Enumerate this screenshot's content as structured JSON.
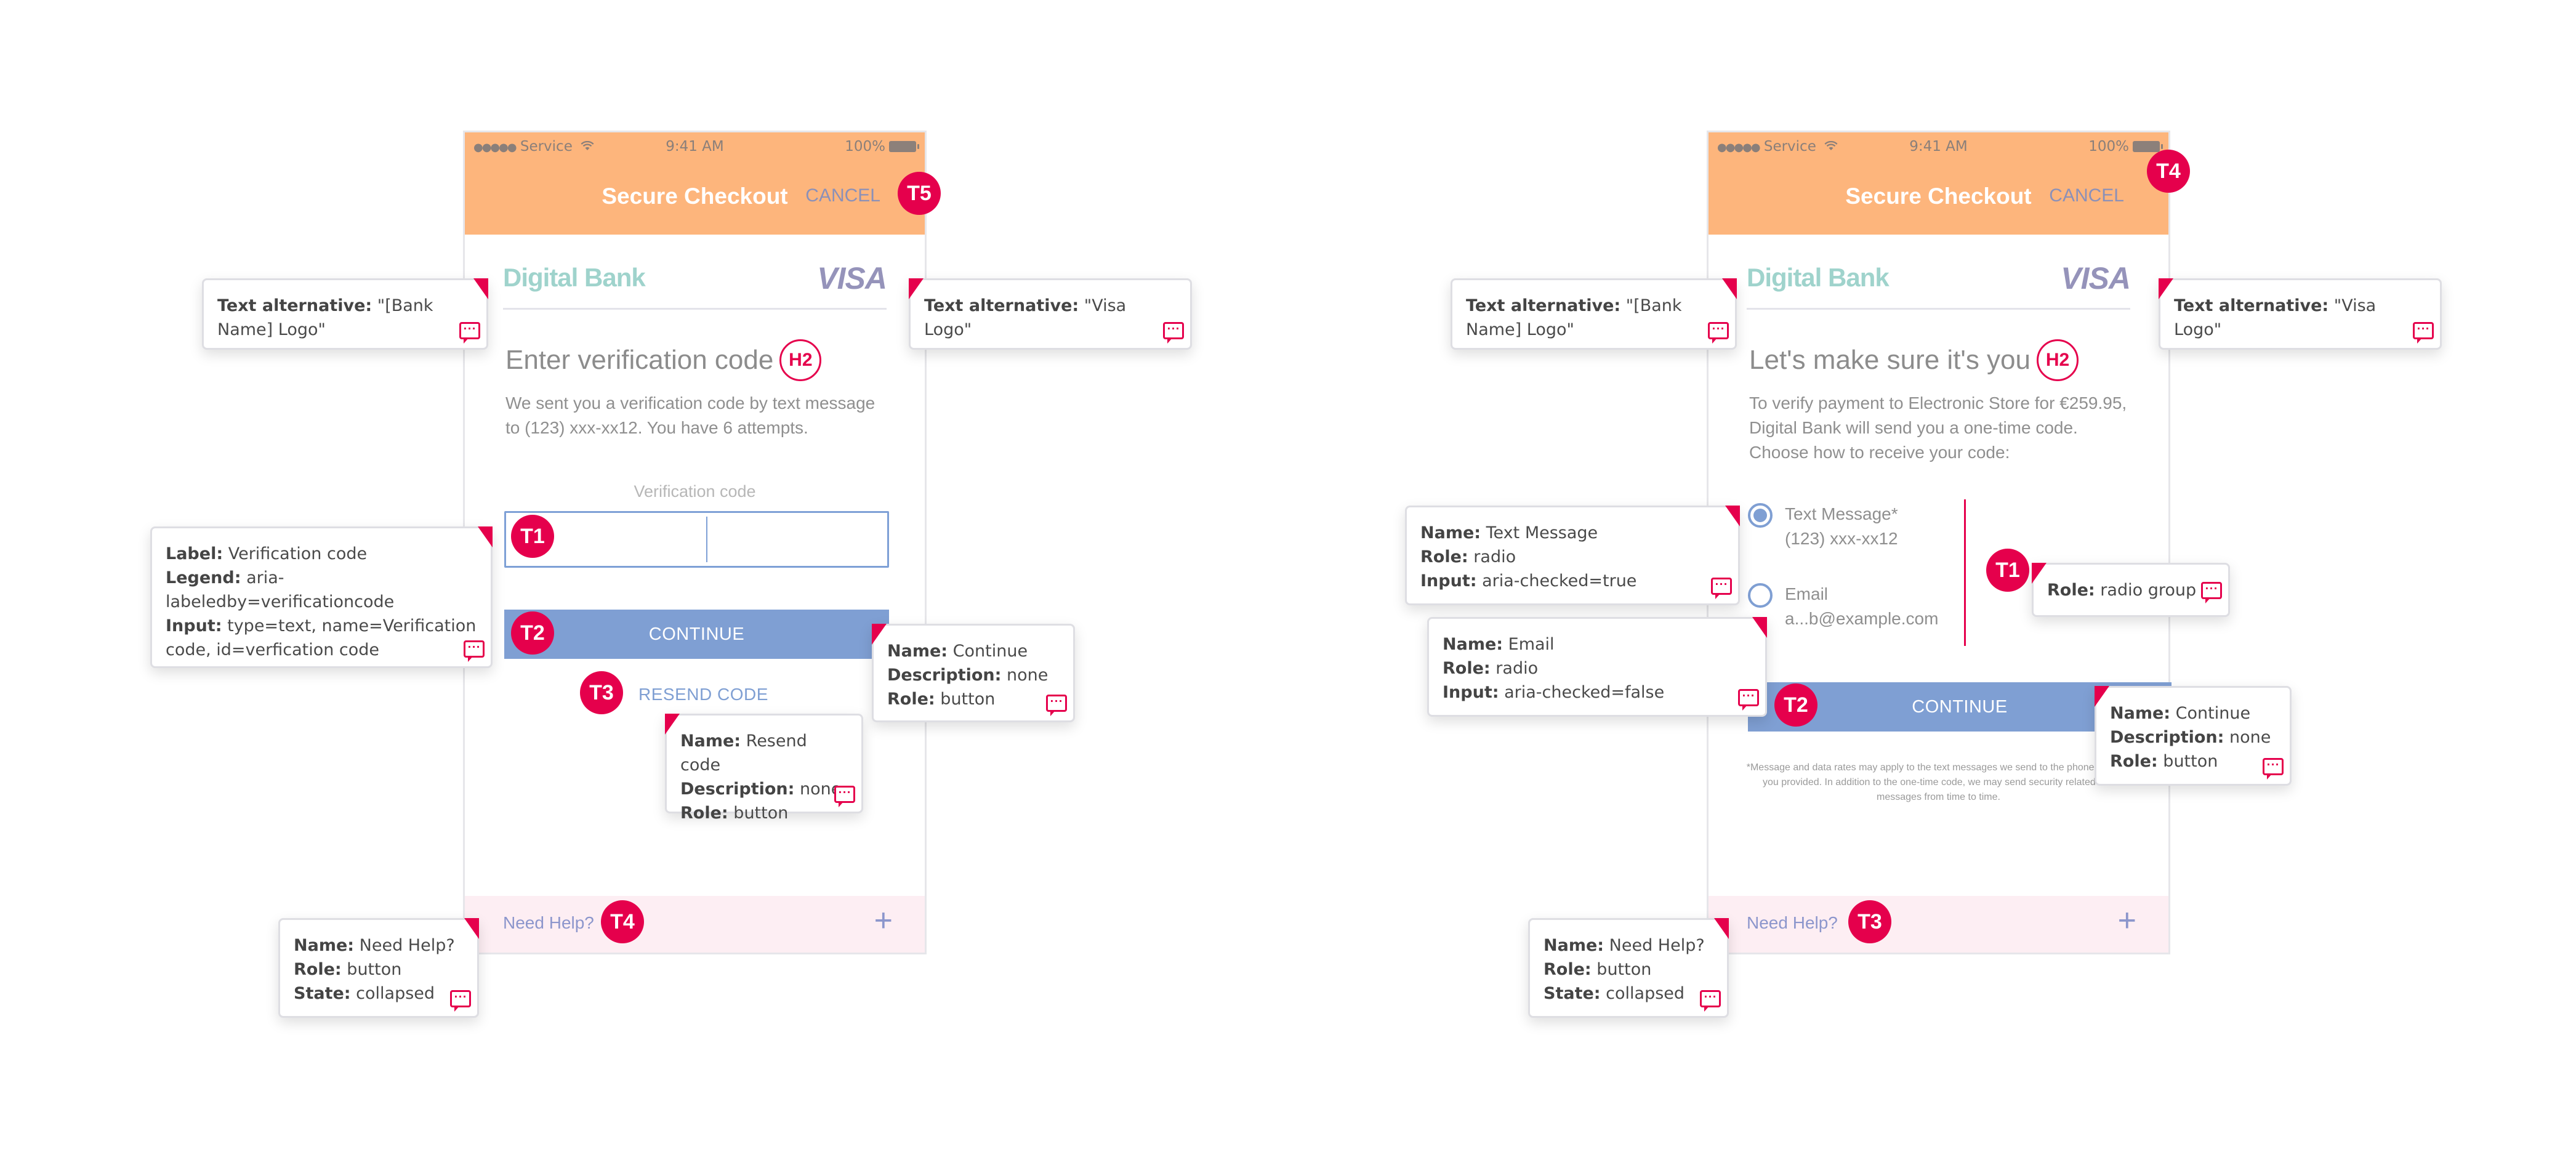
{
  "colors": {
    "header_bg": "#fdb57c",
    "annotation_accent": "#e5004c",
    "button_bg": "#7f9fd3",
    "help_band_bg": "#fdeef3",
    "bank_logo": "#9fd3cc",
    "visa_logo": "#9593ba"
  },
  "icons": {
    "comment": "speech-bubble-with-ellipsis",
    "wifi": "wifi-icon",
    "battery": "battery-full-icon",
    "signal": "signal-dots-icon",
    "plus": "plus-icon"
  },
  "status_bar": {
    "signal": "●●●●●",
    "carrier": "Service",
    "time": "9:41 AM",
    "battery": "100%"
  },
  "screens": [
    {
      "header": {
        "title": "Secure Checkout",
        "cancel": "CANCEL",
        "cancel_tag": "T5"
      },
      "bank_logo": "Digital Bank",
      "visa_logo": "VISA",
      "heading": "Enter verification code",
      "heading_tag": "H2",
      "description": "We sent you a verification code by text message to (123) xxx-xx12. You have 6 attempts.",
      "input_label": "Verification code",
      "input_value": "",
      "input_tag": "T1",
      "continue_label": "CONTINUE",
      "continue_tag": "T2",
      "resend_label": "RESEND CODE",
      "resend_tag": "T3",
      "help_label": "Need Help?",
      "help_tag": "T4",
      "help_icon": "+",
      "callouts": {
        "bank_logo": [
          {
            "k": "Text alternative:",
            "v": " \"[Bank Name] Logo\""
          }
        ],
        "visa_logo": [
          {
            "k": "Text alternative:",
            "v": " \"Visa Logo\""
          }
        ],
        "input": [
          {
            "k": "Label:",
            "v": " Verification code"
          },
          {
            "k": "Legend:",
            "v": " aria-labeledby=verificationcode"
          },
          {
            "k": "Input:",
            "v": " type=text, name=Verification code, id=verfication code"
          }
        ],
        "continue": [
          {
            "k": "Name:",
            "v": " Continue"
          },
          {
            "k": "Description:",
            "v": " none"
          },
          {
            "k": "Role:",
            "v": " button"
          }
        ],
        "resend": [
          {
            "k": "Name:",
            "v": " Resend code"
          },
          {
            "k": "Description:",
            "v": " none"
          },
          {
            "k": "Role:",
            "v": " button"
          }
        ],
        "help": [
          {
            "k": "Name:",
            "v": " Need Help?"
          },
          {
            "k": "Role:",
            "v": " button"
          },
          {
            "k": "State:",
            "v": " collapsed"
          }
        ]
      }
    },
    {
      "header": {
        "title": "Secure Checkout",
        "cancel": "CANCEL",
        "cancel_tag": "T4"
      },
      "bank_logo": "Digital Bank",
      "visa_logo": "VISA",
      "heading": "Let's make sure it's you",
      "heading_tag": "H2",
      "description": "To verify payment to Electronic Store for €259.95, Digital Bank will send you a one-time code. Choose how to receive your code:",
      "radio_options": [
        {
          "label": "Text Message*",
          "detail": "(123) xxx-xx12",
          "checked": true
        },
        {
          "label": "Email",
          "detail": "a...b@example.com",
          "checked": false
        }
      ],
      "radio_group_tag": "T1",
      "continue_label": "CONTINUE",
      "continue_tag": "T2",
      "disclaimer": "*Message and data rates may apply to the text messages we send to the phone number you provided. In addition to the one-time code, we may send security related text messages from time to time.",
      "help_label": "Need Help?",
      "help_tag": "T3",
      "help_icon": "+",
      "callouts": {
        "bank_logo": [
          {
            "k": "Text alternative:",
            "v": " \"[Bank Name] Logo\""
          }
        ],
        "visa_logo": [
          {
            "k": "Text alternative:",
            "v": " \"Visa Logo\""
          }
        ],
        "radio_text": [
          {
            "k": "Name:",
            "v": " Text Message"
          },
          {
            "k": "Role:",
            "v": " radio"
          },
          {
            "k": "Input:",
            "v": " aria-checked=true"
          }
        ],
        "radio_email": [
          {
            "k": "Name:",
            "v": " Email"
          },
          {
            "k": "Role:",
            "v": " radio"
          },
          {
            "k": "Input:",
            "v": " aria-checked=false"
          }
        ],
        "radio_group": [
          {
            "k": "Role:",
            "v": " radio group"
          }
        ],
        "continue": [
          {
            "k": "Name:",
            "v": " Continue"
          },
          {
            "k": "Description:",
            "v": " none"
          },
          {
            "k": "Role:",
            "v": " button"
          }
        ],
        "help": [
          {
            "k": "Name:",
            "v": " Need Help?"
          },
          {
            "k": "Role:",
            "v": " button"
          },
          {
            "k": "State:",
            "v": " collapsed"
          }
        ]
      }
    }
  ]
}
